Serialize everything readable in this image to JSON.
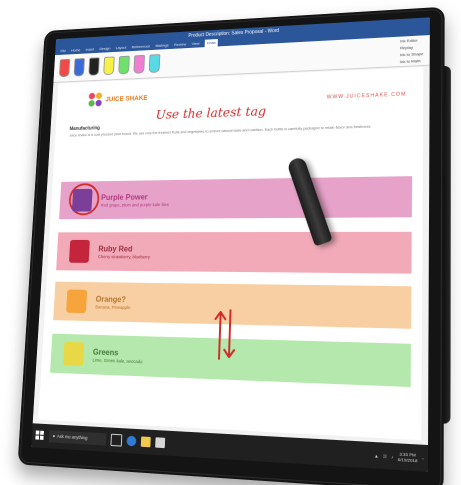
{
  "word": {
    "title": "Product Description: Sales Proposal - Word",
    "tabs": [
      "File",
      "Home",
      "Insert",
      "Design",
      "Layout",
      "References",
      "Mailings",
      "Review",
      "View",
      "Draw"
    ],
    "active_tab": "Draw",
    "ribbon_right": [
      "Ink Editor",
      "Replay",
      "Ink to Shape",
      "Ink to Math"
    ]
  },
  "document": {
    "logo_text": "JUICE SHAKE",
    "website": "WWW.JUICESHAKE.COM",
    "heading": "Manufacturing",
    "paragraph": "Juice shake is a cold-pressed juice brand. We use only the freshest fruits and vegetables to ensure natural taste and nutrition. Each bottle is carefully packaged to retain flavor and freshness.",
    "annotation": "Use the latest tag",
    "products": [
      {
        "name": "Purple Power",
        "desc": "Red grape, plum and purple kale files",
        "color": "#e6a2c8",
        "text_color": "#b03a83"
      },
      {
        "name": "Ruby Red",
        "desc": "Cherry strawberry, blueberry",
        "color": "#f2aab8",
        "text_color": "#9b2c3f"
      },
      {
        "name": "Orange?",
        "desc": "Banana, Pineapple",
        "color": "#f7cfa2",
        "text_color": "#b4762b"
      },
      {
        "name": "Greens",
        "desc": "Lime, Green kale, avocado",
        "color": "#b4e8ac",
        "text_color": "#3f7b35"
      }
    ]
  },
  "taskbar": {
    "search_placeholder": "Ask me anything",
    "time": "3:33 PM",
    "date": "6/19/2018",
    "icons": [
      "task-view-icon",
      "edge-icon",
      "file-explorer-icon",
      "store-icon"
    ]
  },
  "colors": {
    "accent": "#2b579a",
    "annotation": "#d12b2b"
  }
}
